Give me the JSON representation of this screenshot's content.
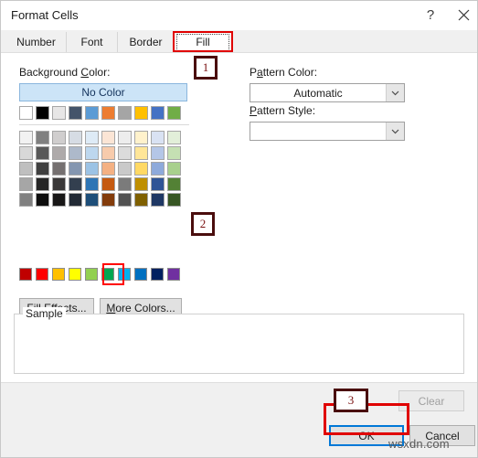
{
  "dialog": {
    "title": "Format Cells",
    "help_icon": "question-mark-icon",
    "close_icon": "close-icon"
  },
  "tabs": [
    {
      "id": "number",
      "label": "Number",
      "active": false
    },
    {
      "id": "font",
      "label": "Font",
      "active": false
    },
    {
      "id": "border",
      "label": "Border",
      "active": false
    },
    {
      "id": "fill",
      "label": "Fill",
      "active": true
    }
  ],
  "fill_tab": {
    "background_color_label": "Background Color:",
    "no_color_label": "No Color",
    "pattern_color_label": "Pattern Color:",
    "pattern_color_value": "Automatic",
    "pattern_style_label": "Pattern Style:",
    "pattern_style_value": "",
    "fill_effects_label": "Fill Effects...",
    "more_colors_label": "More Colors...",
    "sample_label": "Sample",
    "selected_standard_color": "#00a651",
    "theme_colors": {
      "row_top": [
        "#ffffff",
        "#000000",
        "#e7e6e6",
        "#44546a",
        "#5b9bd5",
        "#ed7d31",
        "#a5a5a5",
        "#ffc000",
        "#4472c4",
        "#70ad47"
      ],
      "row_2": [
        "#f2f2f2",
        "#808080",
        "#d0cece",
        "#d6dce4",
        "#deebf6",
        "#fbe5d5",
        "#ededed",
        "#fff2cc",
        "#d9e2f3",
        "#e2efd9"
      ],
      "row_3": [
        "#d8d8d8",
        "#595959",
        "#aeaaaa",
        "#adb9ca",
        "#bdd7ee",
        "#f7cbac",
        "#dbdbdb",
        "#ffe698",
        "#b4c6e7",
        "#c5e0b3"
      ],
      "row_4": [
        "#bfbfbf",
        "#404040",
        "#757070",
        "#8496b0",
        "#9cc3e5",
        "#f4b183",
        "#c9c9c9",
        "#ffd965",
        "#8eaadb",
        "#a8d08d"
      ],
      "row_5": [
        "#a6a6a6",
        "#262626",
        "#3a3838",
        "#333f4f",
        "#2e75b5",
        "#c55a11",
        "#7b7b7b",
        "#bf8f00",
        "#2f5496",
        "#538135"
      ],
      "row_6": [
        "#808080",
        "#0d0d0d",
        "#181717",
        "#222a35",
        "#1e4e79",
        "#833c0b",
        "#525252",
        "#7f6000",
        "#1f3864",
        "#375623"
      ]
    },
    "standard_colors": [
      "#c00000",
      "#ff0000",
      "#ffc000",
      "#ffff00",
      "#92d050",
      "#00a651",
      "#00b0f0",
      "#0070c0",
      "#002060",
      "#7030a0"
    ]
  },
  "footer": {
    "clear_label": "Clear",
    "ok_label": "OK",
    "cancel_label": "Cancel"
  },
  "annotations": {
    "step1": "1",
    "step2": "2",
    "step3": "3"
  },
  "watermark": "wsxdn.com",
  "colors": {
    "annotation_red": "#e00000",
    "annotation_dark_red": "#4a0d0d",
    "focus_blue": "#0078d7",
    "dialog_bg": "#ffffff",
    "footer_bg": "#f0f0f0"
  }
}
